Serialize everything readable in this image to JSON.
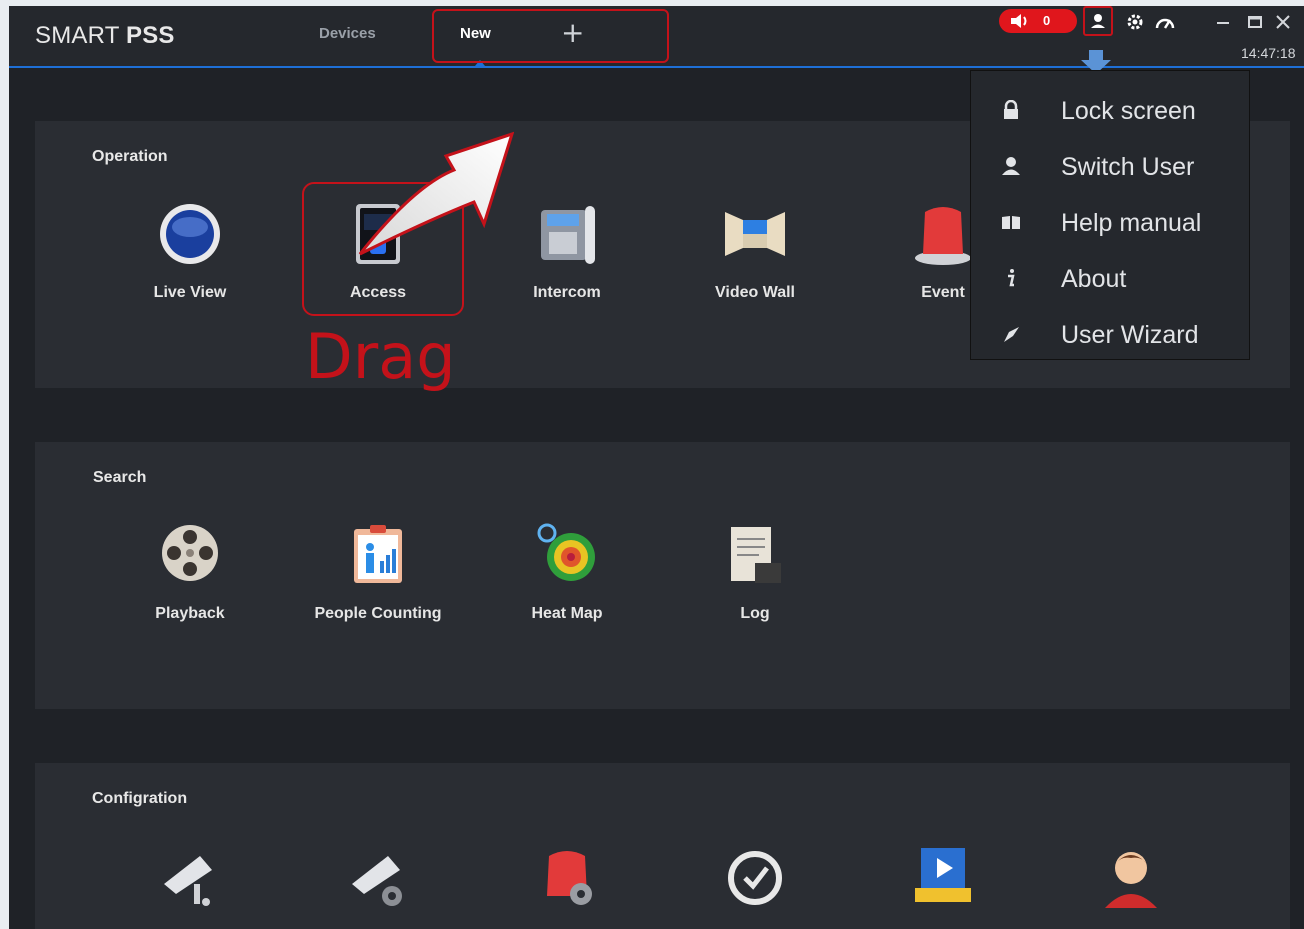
{
  "app": {
    "title_light": "SMART ",
    "title_bold": "PSS",
    "clock": "14:47:18"
  },
  "tabs": {
    "devices": "Devices",
    "new": "New",
    "add": "+"
  },
  "alarm": {
    "count": "0"
  },
  "sections": {
    "operation": {
      "title": "Operation",
      "items": [
        "Live View",
        "Access",
        "Intercom",
        "Video Wall",
        "Event"
      ]
    },
    "search": {
      "title": "Search",
      "items": [
        "Playback",
        "People Counting",
        "Heat Map",
        "Log"
      ]
    },
    "configuration": {
      "title": "Configration"
    }
  },
  "annotation": {
    "drag": "Drag"
  },
  "user_menu": {
    "items": [
      "Lock screen",
      "Switch User",
      "Help manual",
      "About",
      "User Wizard"
    ]
  },
  "colors": {
    "accent": "#1e6fd6",
    "highlight": "#c4121a",
    "panel": "#2a2d33",
    "bg": "#1f2227"
  }
}
